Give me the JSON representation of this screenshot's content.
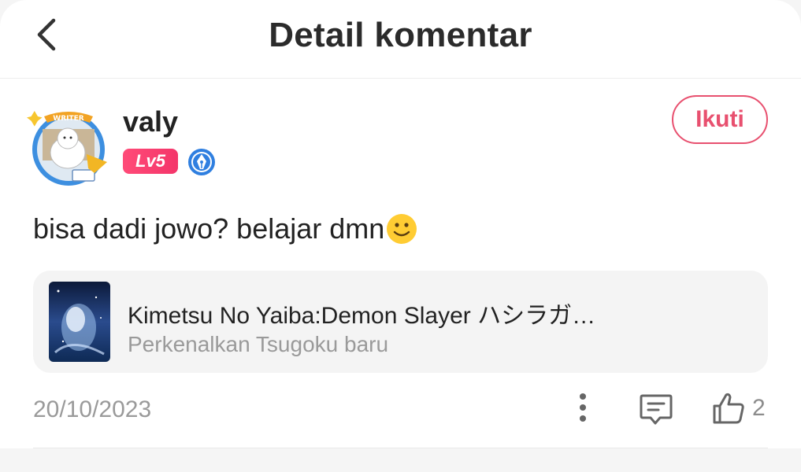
{
  "header": {
    "title": "Detail komentar",
    "back_icon": "chevron-left-icon"
  },
  "comment": {
    "username": "valy",
    "level": "Lv5",
    "avatar_badge_text": "WRITER",
    "follow_label": "Ikuti",
    "text": "bisa dadi jowo? belajar dmn",
    "emoji": "slightly-smiling-face",
    "date": "20/10/2023",
    "like_count": "2"
  },
  "book": {
    "title": "Kimetsu No Yaiba:Demon Slayer ハシラガ…",
    "subtitle": "Perkenalkan Tsugoku baru"
  },
  "colors": {
    "accent": "#e8506f",
    "level_badge": "#f4356a",
    "muted_text": "#9a9a9a",
    "card_bg": "#f4f4f4"
  }
}
